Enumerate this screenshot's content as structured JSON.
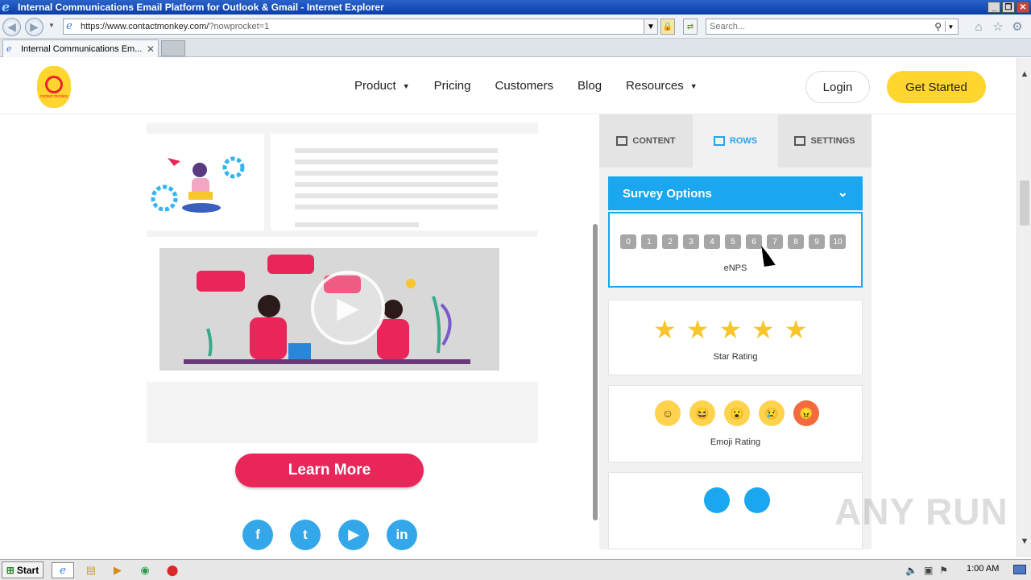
{
  "window": {
    "title": "Internal Communications Email Platform for Outlook & Gmail - Internet Explorer",
    "controls": [
      "_",
      "❐",
      "✕"
    ]
  },
  "navbar": {
    "url_main": "https://www.contactmonkey.com/",
    "url_query": "?nowprocket=1",
    "search_placeholder": "Search..."
  },
  "tabs": [
    {
      "title": "Internal Communications Em...",
      "close": "✕"
    }
  ],
  "site": {
    "logo_text": "contact monkey",
    "menu": [
      {
        "label": "Product",
        "caret": "▼"
      },
      {
        "label": "Pricing"
      },
      {
        "label": "Customers"
      },
      {
        "label": "Blog"
      },
      {
        "label": "Resources",
        "caret": "▼"
      }
    ],
    "login": "Login",
    "get_started": "Get Started"
  },
  "video": {
    "learn_more": "Learn More",
    "social": [
      "f",
      "t",
      "▶",
      "in"
    ],
    "panel_tabs": [
      "CONTENT",
      "ROWS",
      "SETTINGS"
    ],
    "survey_title": "Survey Options",
    "nps_values": [
      "0",
      "1",
      "2",
      "3",
      "4",
      "5",
      "6",
      "7",
      "8",
      "9",
      "10"
    ],
    "nps_label": "eNPS",
    "star_label": "Star Rating",
    "emoji_label": "Emoji Rating",
    "stars": [
      "★",
      "★",
      "★",
      "★",
      "★"
    ],
    "emojis": [
      "☺",
      "😆",
      "😮",
      "😢",
      "😠"
    ]
  },
  "watermark": "ANY RUN",
  "taskbar": {
    "start": "Start",
    "clock": "1:00 AM"
  },
  "colors": {
    "brand_yellow": "#ffd52e",
    "survey_blue": "#1aa7ef",
    "learn_pink": "#e8265a"
  }
}
